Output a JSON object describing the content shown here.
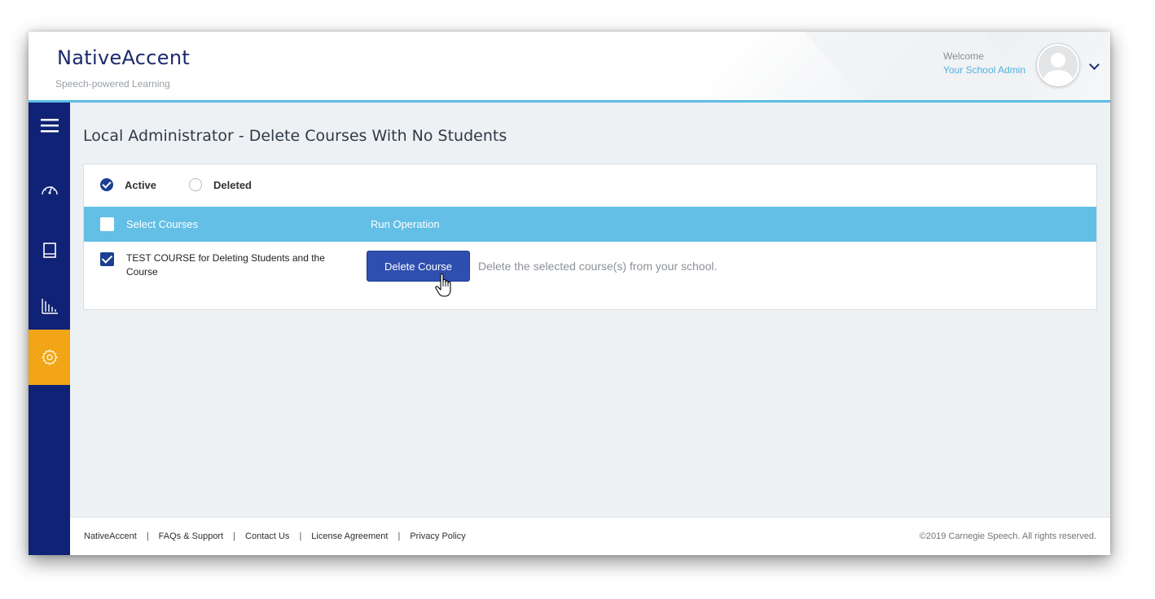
{
  "app": {
    "brand": "NativeAccent",
    "tagline": "Speech-powered Learning"
  },
  "user": {
    "welcome": "Welcome",
    "name": "Your School Admin"
  },
  "sidebar": {
    "items": [
      {
        "icon": "menu-icon"
      },
      {
        "icon": "dashboard-gauge-icon"
      },
      {
        "icon": "book-icon"
      },
      {
        "icon": "bar-chart-icon"
      },
      {
        "icon": "gear-icon",
        "active": true
      }
    ]
  },
  "page": {
    "title": "Local Administrator - Delete Courses With No Students"
  },
  "filter": {
    "options": [
      {
        "label": "Active",
        "selected": true
      },
      {
        "label": "Deleted",
        "selected": false
      }
    ]
  },
  "table": {
    "headers": [
      "Select Courses",
      "Run Operation"
    ],
    "rows": [
      {
        "course": "TEST COURSE for Deleting Students and the Course",
        "checked": true
      }
    ]
  },
  "operation": {
    "button_label": "Delete Course",
    "description": "Delete the selected course(s) from your school."
  },
  "footer": {
    "links": [
      "NativeAccent",
      "FAQs & Support",
      "Contact Us",
      "License Agreement",
      "Privacy Policy"
    ],
    "copyright": "©2019 Carnegie Speech. All rights reserved."
  },
  "colors": {
    "sidebar": "#0f2275",
    "active_accent": "#f2a516",
    "table_header": "#63bfe6",
    "primary_button": "#2f4fb0"
  }
}
